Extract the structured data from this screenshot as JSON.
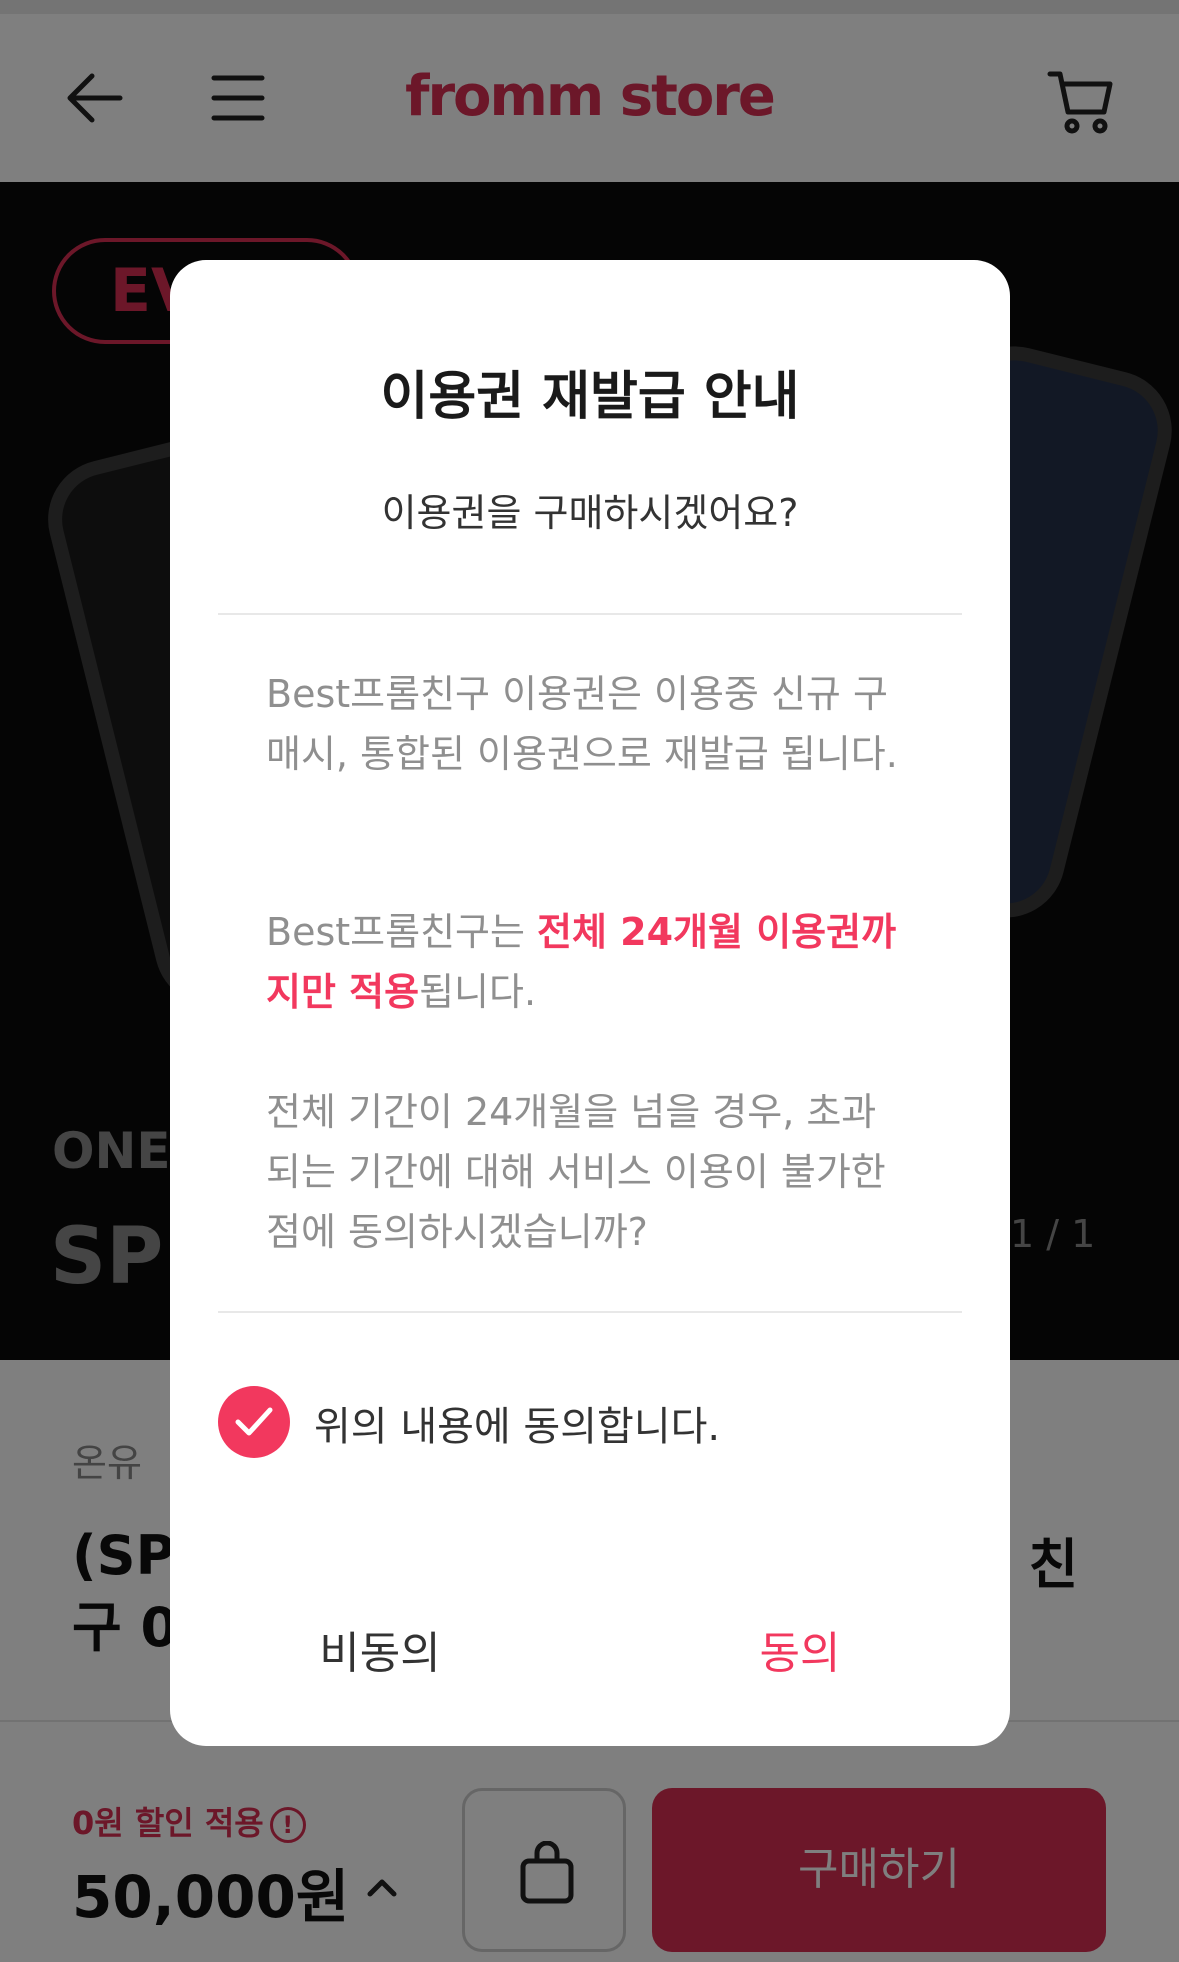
{
  "header": {
    "logo": "fromm store"
  },
  "hero": {
    "badge": "EV",
    "subtitle": "ONE",
    "big_text": "SPE",
    "pager": "1 / 1"
  },
  "product": {
    "brand": "온유",
    "title_line1": "(SP",
    "title_line2": "구 0",
    "title_right": "롬 친"
  },
  "bottom": {
    "discount": "0원 할인 적용",
    "price": "50,000원",
    "buy_label": "구매하기"
  },
  "modal": {
    "title": "이용권 재발급 안내",
    "subtitle": "이용권을 구매하시겠어요?",
    "para1": "Best프롬친구 이용권은 이용중 신규 구매시, 통합된 이용권으로 재발급 됩니다.",
    "para2_prefix": "Best프롬친구는 ",
    "para2_highlight": "전체 24개월 이용권까지만 적용",
    "para2_suffix": "됩니다.",
    "para3": "전체 기간이 24개월을 넘을 경우, 초과되는 기간에 대해 서비스 이용이 불가한 점에 동의하시겠습니까?",
    "agree_label": "위의 내용에 동의합니다.",
    "agree_checked": true,
    "disagree_button": "비동의",
    "agree_button": "동의"
  },
  "colors": {
    "brand": "#d92e52",
    "accent": "#f2385e"
  }
}
